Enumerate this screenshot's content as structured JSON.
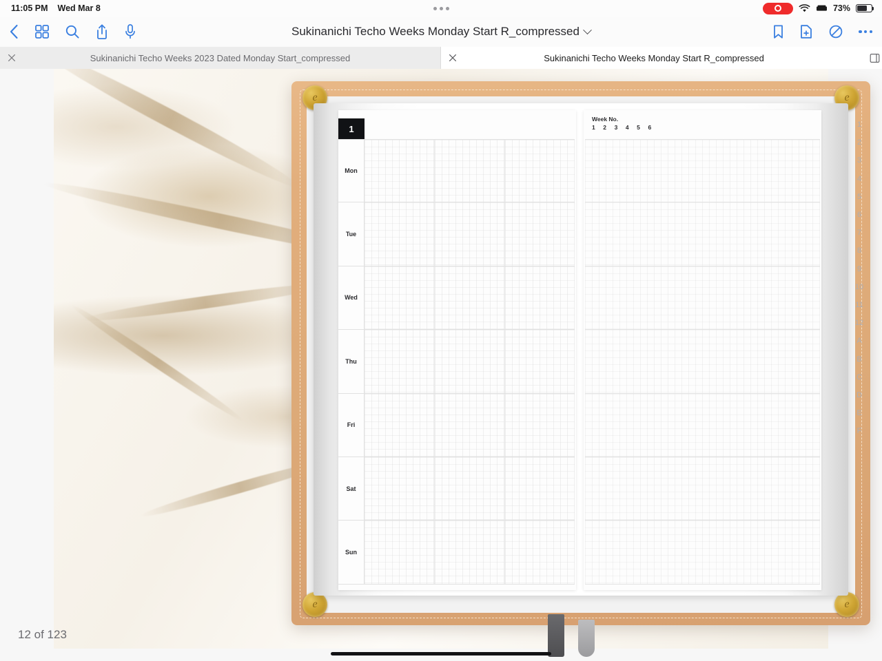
{
  "statusbar": {
    "time": "11:05 PM",
    "date": "Wed Mar 8",
    "battery_percent": "73%",
    "icons": {
      "recording": "record-pill-icon",
      "wifi": "wifi-icon",
      "keyboard": "keyboard-icon",
      "battery": "battery-icon",
      "multitask": "multitask-handle-icon"
    }
  },
  "toolbar": {
    "title": "Sukinanichi Techo Weeks Monday Start R_compressed",
    "left_buttons": [
      {
        "name": "back-button",
        "icon": "chevron-left-icon"
      },
      {
        "name": "thumbnails-button",
        "icon": "grid-icon"
      },
      {
        "name": "search-button",
        "icon": "search-icon"
      },
      {
        "name": "share-button",
        "icon": "share-icon"
      },
      {
        "name": "microphone-button",
        "icon": "microphone-icon"
      }
    ],
    "right_buttons": [
      {
        "name": "bookmark-button",
        "icon": "bookmark-icon"
      },
      {
        "name": "add-page-button",
        "icon": "document-plus-icon"
      },
      {
        "name": "markup-button",
        "icon": "circle-slash-icon"
      },
      {
        "name": "more-button",
        "icon": "ellipsis-icon"
      }
    ]
  },
  "tabs": [
    {
      "label": "Sukinanichi Techo Weeks 2023 Dated Monday Start_compressed",
      "active": false
    },
    {
      "label": "Sukinanichi Techo Weeks Monday Start R_compressed",
      "active": true
    }
  ],
  "tab_bar": {
    "split_view_icon": "split-view-icon"
  },
  "document": {
    "page_indicator": "12 of 123",
    "left_page": {
      "week_number": "1",
      "day_labels": [
        "Mon",
        "Tue",
        "Wed",
        "Thu",
        "Fri",
        "Sat",
        "Sun"
      ],
      "columns_per_day": 3
    },
    "right_page": {
      "week_no_label": "Week No.",
      "week_numbers": "1  2  3  4  5  6",
      "row_count": 7
    },
    "index_tabs": [
      "1",
      "2",
      "3",
      "4",
      "5",
      "6",
      "7",
      "8",
      "9",
      "10",
      "11",
      "12",
      "A",
      "B",
      "C",
      "D",
      "E",
      "F"
    ],
    "medallion_mark": "e"
  },
  "colors": {
    "accent": "#3a7fe0",
    "record_red": "#ef2b2b",
    "badge_black": "#111215",
    "cover_tan": "#e2ae7c",
    "gold": "#cfa534"
  }
}
